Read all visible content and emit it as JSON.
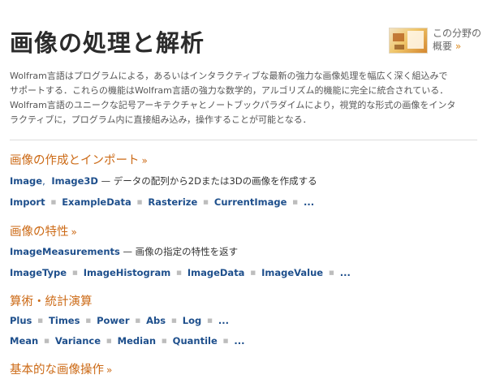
{
  "page": {
    "title": "画像の処理と解析",
    "overview": {
      "line1": "この分野の",
      "line2": "概要",
      "arrow": "»"
    },
    "intro": [
      "Wolfram言語はプログラムによる，あるいはインタラクティブな最新の強力な画像処理を幅広く深く組込みで",
      "サポートする．これらの機能はWolfram言語の強力な数学的，アルゴリズム的機能に完全に統合されている．",
      "Wolfram言語のユニークな記号アーキテクチャとノートブックパラダイムにより，視覚的な形式の画像をインタ",
      "ラクティブに，プログラム内に直接組み込み，操作することが可能となる．"
    ]
  },
  "sections": [
    {
      "title": "画像の作成とインポート",
      "chevron": "»",
      "desc_line": {
        "functions": [
          "Image",
          "Image3D"
        ],
        "description": "— データの配列から2Dまたは3Dの画像を作成する"
      },
      "list": [
        "Import",
        "ExampleData",
        "Rasterize",
        "CurrentImage",
        "..."
      ]
    },
    {
      "title": "画像の特性",
      "chevron": "»",
      "desc_line": {
        "functions": [
          "ImageMeasurements"
        ],
        "description": "— 画像の指定の特性を返す"
      },
      "list": [
        "ImageType",
        "ImageHistogram",
        "ImageData",
        "ImageValue",
        "..."
      ]
    },
    {
      "title": "算術・統計演算",
      "chevron": "",
      "list1": [
        "Plus",
        "Times",
        "Power",
        "Abs",
        "Log",
        "..."
      ],
      "list2": [
        "Mean",
        "Variance",
        "Median",
        "Quantile",
        "..."
      ]
    },
    {
      "title": "基本的な画像操作",
      "chevron": "»"
    }
  ],
  "colors": {
    "accent": "#cc6a16",
    "link": "#1e4f8c",
    "text": "#333333"
  }
}
